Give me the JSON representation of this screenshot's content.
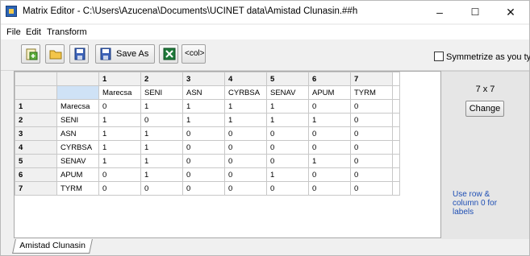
{
  "window": {
    "title": "Matrix Editor - C:\\Users\\Azucena\\Documents\\UCINET data\\Amistad Clunasin.##h",
    "minimize": "–",
    "maximize": "☐",
    "close": "✕"
  },
  "menu": [
    "File",
    "Edit",
    "Transform"
  ],
  "toolbar": {
    "save_as_label": "Save As",
    "col_label": "<col>",
    "symmetrize_label": "Symmetrize as you type",
    "symmetrize_checked": false
  },
  "grid": {
    "col_numbers": [
      "1",
      "2",
      "3",
      "4",
      "5",
      "6",
      "7"
    ],
    "row_numbers": [
      "1",
      "2",
      "3",
      "4",
      "5",
      "6",
      "7"
    ],
    "labels": [
      "Marecsa",
      "SENI",
      "ASN",
      "CYRBSA",
      "SENAV",
      "APUM",
      "TYRM"
    ],
    "row_labels": [
      "Marecsa",
      "SENI",
      "ASN",
      "CYRBSA",
      "SENAV",
      "APUM",
      "TYRM"
    ],
    "values": [
      [
        "0",
        "1",
        "1",
        "1",
        "1",
        "0",
        "0"
      ],
      [
        "1",
        "0",
        "1",
        "1",
        "1",
        "1",
        "0"
      ],
      [
        "1",
        "1",
        "0",
        "0",
        "0",
        "0",
        "0"
      ],
      [
        "1",
        "1",
        "0",
        "0",
        "0",
        "0",
        "0"
      ],
      [
        "1",
        "1",
        "0",
        "0",
        "0",
        "1",
        "0"
      ],
      [
        "0",
        "1",
        "0",
        "0",
        "1",
        "0",
        "0"
      ],
      [
        "0",
        "0",
        "0",
        "0",
        "0",
        "0",
        "0"
      ]
    ]
  },
  "side": {
    "dims": "7 x 7",
    "change_label": "Change",
    "hint": "Use row & column 0 for labels"
  },
  "sheet_tab": "Amistad Clunasin"
}
